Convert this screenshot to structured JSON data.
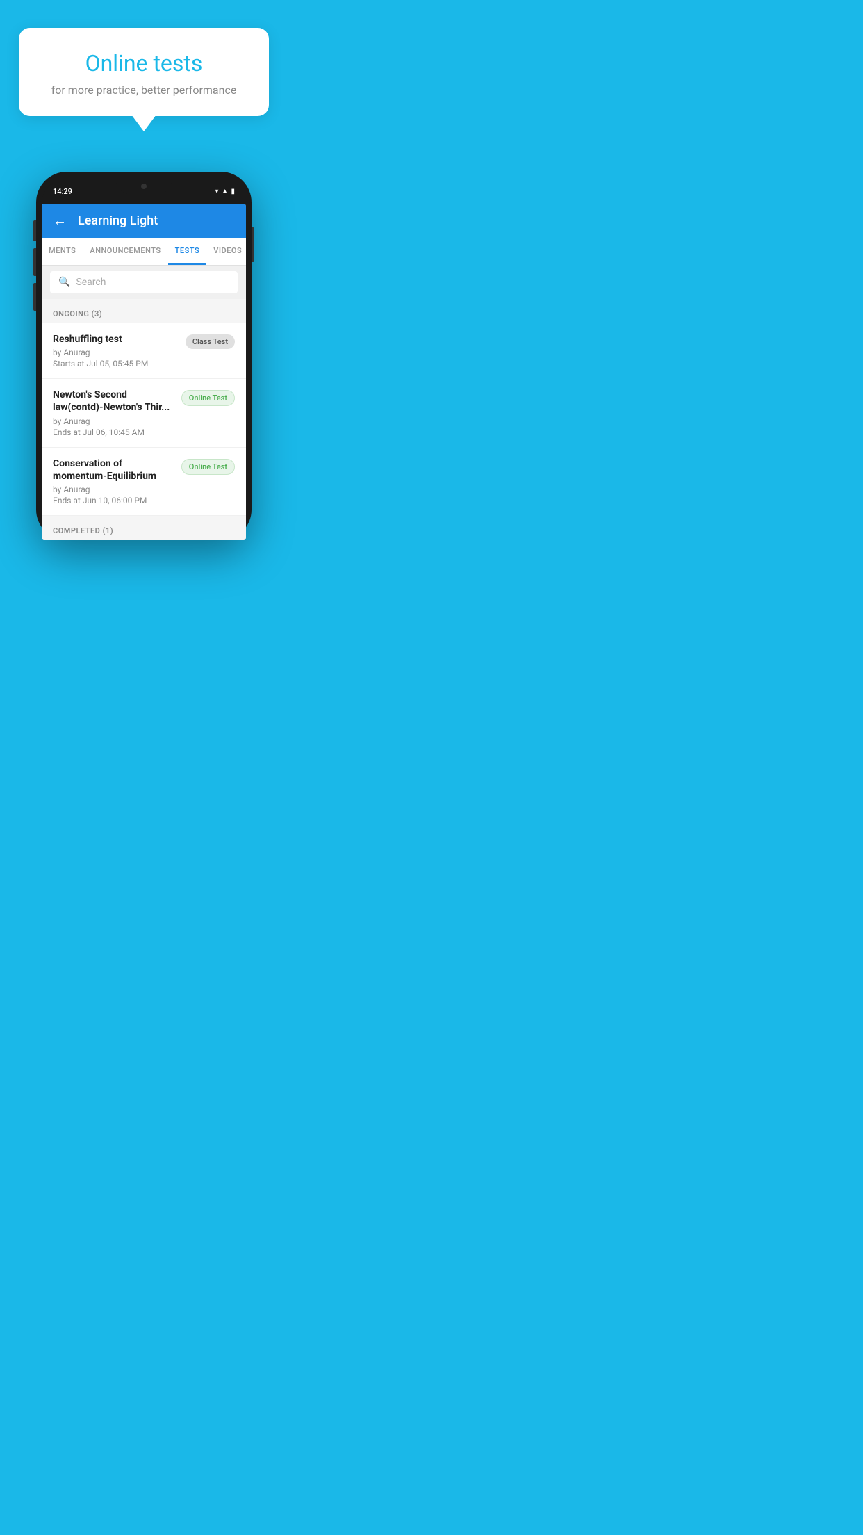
{
  "background_color": "#1ab8e8",
  "bubble": {
    "title": "Online tests",
    "subtitle": "for more practice, better performance"
  },
  "phone": {
    "status_time": "14:29",
    "app_title": "Learning Light",
    "back_label": "←",
    "tabs": [
      {
        "label": "MENTS",
        "active": false
      },
      {
        "label": "ANNOUNCEMENTS",
        "active": false
      },
      {
        "label": "TESTS",
        "active": true
      },
      {
        "label": "VIDEOS",
        "active": false
      }
    ],
    "search_placeholder": "Search",
    "section_ongoing": "ONGOING (3)",
    "section_completed": "COMPLETED (1)",
    "tests": [
      {
        "name": "Reshuffling test",
        "author": "by Anurag",
        "date": "Starts at  Jul 05, 05:45 PM",
        "badge": "Class Test",
        "badge_type": "class"
      },
      {
        "name": "Newton's Second law(contd)-Newton's Thir...",
        "author": "by Anurag",
        "date": "Ends at  Jul 06, 10:45 AM",
        "badge": "Online Test",
        "badge_type": "online"
      },
      {
        "name": "Conservation of momentum-Equilibrium",
        "author": "by Anurag",
        "date": "Ends at  Jun 10, 06:00 PM",
        "badge": "Online Test",
        "badge_type": "online"
      }
    ]
  }
}
